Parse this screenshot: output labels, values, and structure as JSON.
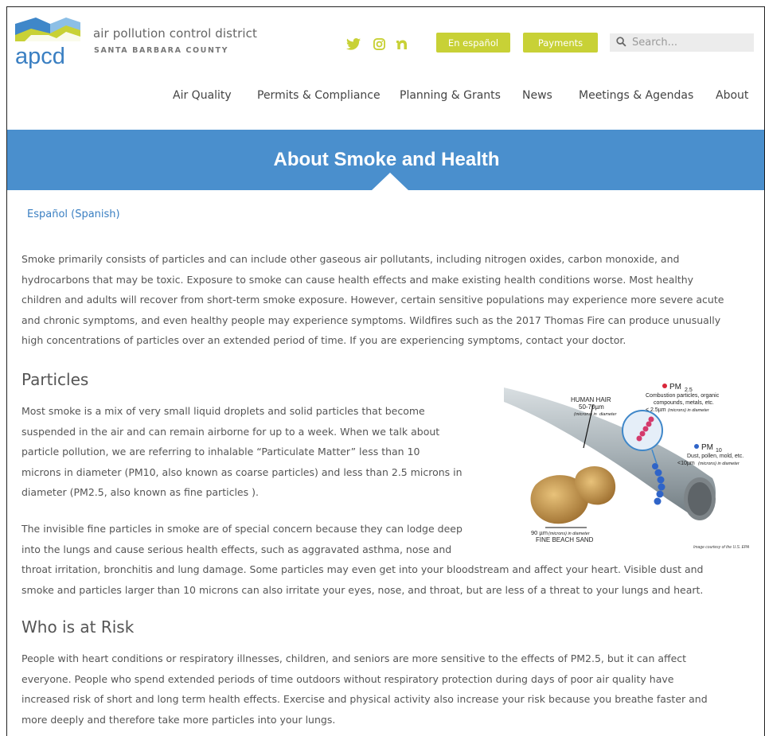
{
  "header": {
    "title": "air pollution control district",
    "subtitle": "SANTA BARBARA COUNTY",
    "logo_text": "apcd",
    "espanol_button": "En español",
    "payments_button": "Payments",
    "search_placeholder": "Search..."
  },
  "nav": {
    "items": [
      "Air Quality",
      "Permits & Compliance",
      "Planning & Grants",
      "News",
      "Meetings & Agendas",
      "About"
    ]
  },
  "banner": {
    "title": "About Smoke and Health"
  },
  "spanish_link": "Español (Spanish)",
  "intro": {
    "lines": [
      "Smoke primarily consists of particles and can include other gaseous air pollutants, including nitrogen oxides, carbon monoxide, and",
      "hydrocarbons that may be toxic. Exposure to smoke can cause health effects and make existing health conditions worse. Most healthy",
      "children and adults will recover from short-term smoke exposure. However, certain sensitive populations may experience more severe acute",
      "and chronic symptoms, and even healthy people may experience symptoms. Wildfires such as the 2017 Thomas Fire can produce unusually",
      "high concentrations of particles over an extended period of time. If you are experiencing symptoms, contact your doctor."
    ]
  },
  "particles": {
    "heading": "Particles",
    "p1_lines": [
      "Most smoke is a mix of very small liquid droplets and solid particles that become",
      "suspended in the air and can remain airborne for up to a week. When we talk about",
      "particle pollution, we are referring to inhalable “Particulate Matter” less than 10",
      "microns in diameter (PM10, also known as coarse particles) and less than 2.5 microns in",
      "diameter (PM2.5, also known as fine particles )."
    ],
    "p2_lines": [
      "The invisible fine particles in smoke are of special concern because they can lodge deep",
      "into the lungs and cause serious health effects, such as aggravated asthma, nose and",
      "throat irritation, bronchitis and lung damage. Some particles may even get into your bloodstream and affect your heart. Visible dust and",
      "smoke and particles larger than 10 microns can also irritate your eyes, nose, and throat, but are less of a threat to your lungs and heart."
    ]
  },
  "figure": {
    "pm25_label": "PM",
    "pm25_sub": "2.5",
    "pm25_desc1": "Combustion particles, organic",
    "pm25_desc2": "compounds, metals, etc.",
    "pm25_size": "< 2.5µm",
    "pm25_size_note": "(microns) in diameter",
    "pm10_label": "PM",
    "pm10_sub": "10",
    "pm10_desc": "Dust, pollen, mold, etc.",
    "pm10_size": "<10µm",
    "pm10_size_note": "(microns) in diameter",
    "hair_label": "HUMAN HAIR",
    "hair_size": "50-70µm",
    "hair_note1": "(microns) in",
    "hair_note2": "diameter",
    "sand_size": "90 µm",
    "sand_note": "(microns) in diameter",
    "sand_label": "FINE BEACH SAND",
    "credit": "Image courtesy of the U.S. EPA"
  },
  "risk": {
    "heading": "Who is at Risk",
    "lines": [
      "People with heart conditions or respiratory illnesses, children, and seniors are more sensitive to the effects of PM2.5, but it can affect",
      "everyone. People who spend extended periods of time outdoors without respiratory protection during days of poor air quality have",
      "increased risk of short and long term health effects. Exercise and physical activity also increase your risk because you breathe faster and",
      "more deeply and therefore take more particles into your lungs."
    ]
  },
  "colors": {
    "accent_green": "#c8d136",
    "banner_blue": "#4a8fcd",
    "link_blue": "#3a7fc2"
  }
}
